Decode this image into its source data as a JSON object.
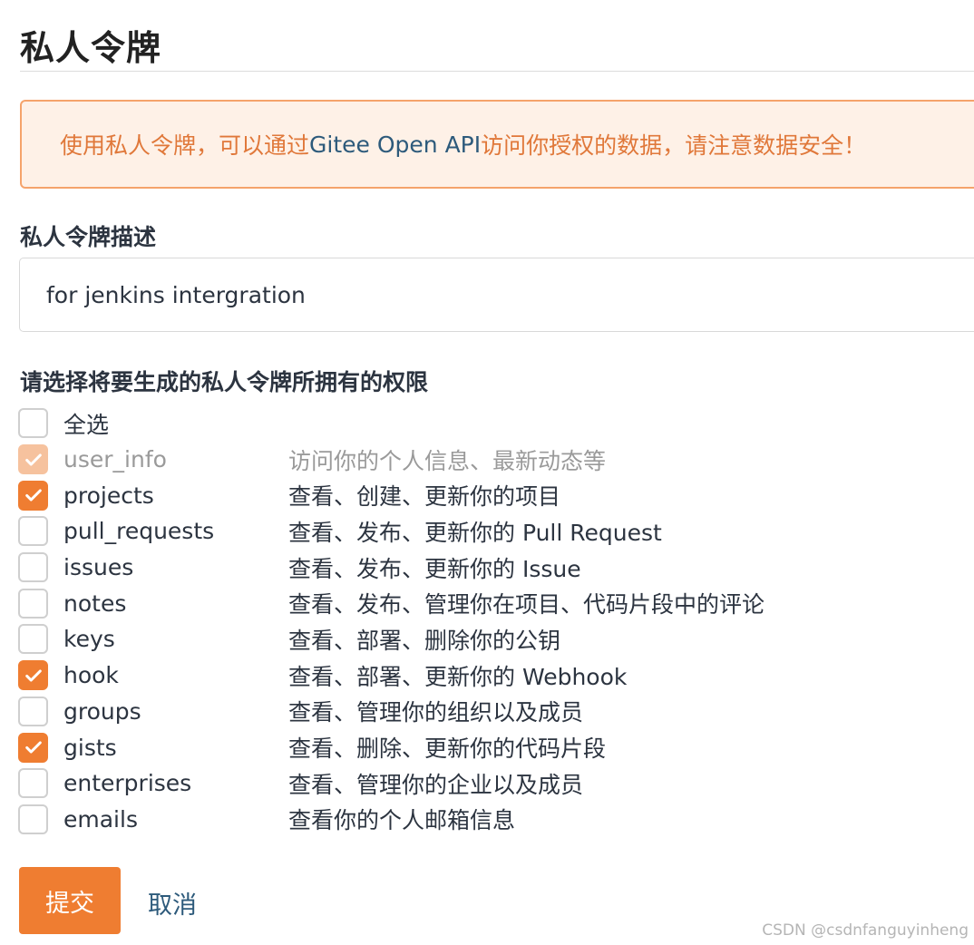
{
  "page": {
    "title": "私人令牌"
  },
  "notice": {
    "prefix": "使用私人令牌，可以通过 ",
    "api_name": "Gitee Open API",
    "suffix": " 访问你授权的数据，请注意数据安全！"
  },
  "description": {
    "label": "私人令牌描述",
    "value": "for jenkins intergration"
  },
  "permissions": {
    "label": "请选择将要生成的私人令牌所拥有的权限",
    "select_all": {
      "label": "全选",
      "checked": false
    },
    "items": [
      {
        "name": "user_info",
        "desc": "访问你的个人信息、最新动态等",
        "checked": true,
        "disabled": true
      },
      {
        "name": "projects",
        "desc": "查看、创建、更新你的项目",
        "checked": true,
        "disabled": false
      },
      {
        "name": "pull_requests",
        "desc": "查看、发布、更新你的 Pull Request",
        "checked": false,
        "disabled": false
      },
      {
        "name": "issues",
        "desc": "查看、发布、更新你的 Issue",
        "checked": false,
        "disabled": false
      },
      {
        "name": "notes",
        "desc": "查看、发布、管理你在项目、代码片段中的评论",
        "checked": false,
        "disabled": false
      },
      {
        "name": "keys",
        "desc": "查看、部署、删除你的公钥",
        "checked": false,
        "disabled": false
      },
      {
        "name": "hook",
        "desc": "查看、部署、更新你的 Webhook",
        "checked": true,
        "disabled": false
      },
      {
        "name": "groups",
        "desc": "查看、管理你的组织以及成员",
        "checked": false,
        "disabled": false
      },
      {
        "name": "gists",
        "desc": "查看、删除、更新你的代码片段",
        "checked": true,
        "disabled": false
      },
      {
        "name": "enterprises",
        "desc": "查看、管理你的企业以及成员",
        "checked": false,
        "disabled": false
      },
      {
        "name": "emails",
        "desc": "查看你的个人邮箱信息",
        "checked": false,
        "disabled": false
      }
    ]
  },
  "actions": {
    "submit": "提交",
    "cancel": "取消"
  },
  "watermark": "CSDN @csdnfanguyinheng",
  "colors": {
    "accent": "#ef7d31",
    "link": "#2d5a7b",
    "notice_bg": "#fef1e7",
    "notice_text": "#e0783a"
  }
}
